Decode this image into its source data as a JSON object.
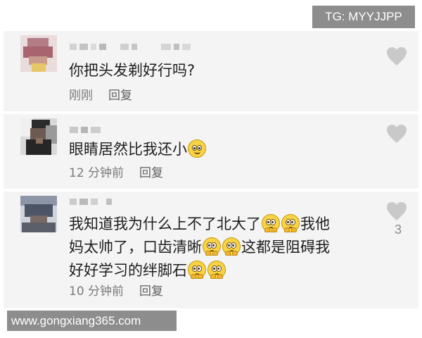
{
  "watermarks": {
    "top_right": "TG: MYYJJPP",
    "bottom_left": "www.gongxiang365.com"
  },
  "comments": [
    {
      "text": "你把头发剃好行吗?",
      "time": "刚刚",
      "reply": "回复",
      "likes": ""
    },
    {
      "text": "眼睛居然比我还小",
      "time": "12 分钟前",
      "reply": "回复",
      "likes": ""
    },
    {
      "text_line1_a": "我知道我为什么上不了北大了",
      "text_line1_b": "我他",
      "text_line2_a": "妈太帅了，口齿清晰",
      "text_line2_b": "这都是阻碍我",
      "text_line3_a": "好好学习的绊脚石",
      "time": "10 分钟前",
      "reply": "回复",
      "likes": "3"
    }
  ],
  "icons": {
    "like": "heart-icon",
    "smile_emoji": "smiling-face-emoji",
    "plead_emoji": "pleading-face-emoji"
  },
  "colors": {
    "card_background": "#f4f4f4",
    "watermark_background": "#8d8d8d",
    "heart": "#c9c9c9",
    "text": "#1e1e1e",
    "meta_text": "#7a7a7a"
  }
}
